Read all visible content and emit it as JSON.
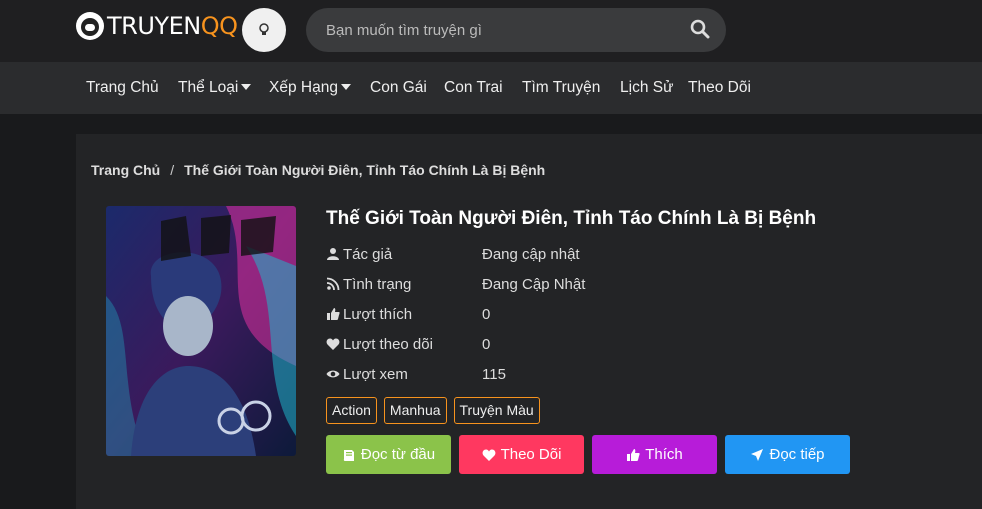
{
  "header": {
    "logo_main": "TRUYEN",
    "logo_accent": "QQ",
    "search_placeholder": "Bạn muốn tìm truyện gì"
  },
  "nav": {
    "items": [
      {
        "label": "Trang Chủ"
      },
      {
        "label": "Thể Loại"
      },
      {
        "label": "Xếp Hạng"
      },
      {
        "label": "Con Gái"
      },
      {
        "label": "Con Trai"
      },
      {
        "label": "Tìm Truyện"
      },
      {
        "label": "Lịch Sử"
      },
      {
        "label": "Theo Dõi"
      }
    ]
  },
  "breadcrumb": {
    "home": "Trang Chủ",
    "separator": "/",
    "current": "Thế Giới Toàn Người Điên, Tỉnh Táo Chính Là Bị Bệnh"
  },
  "comic": {
    "title": "Thế Giới Toàn Người Điên, Tỉnh Táo Chính Là Bị Bệnh",
    "info": [
      {
        "label": "Tác giả",
        "value": "Đang cập nhật",
        "icon": "user-icon"
      },
      {
        "label": "Tình trạng",
        "value": "Đang Cập Nhật",
        "icon": "rss-icon"
      },
      {
        "label": "Lượt thích",
        "value": "0",
        "icon": "thumbs-up-icon"
      },
      {
        "label": "Lượt theo dõi",
        "value": "0",
        "icon": "heart-icon"
      },
      {
        "label": "Lượt xem",
        "value": "115",
        "icon": "eye-icon"
      }
    ],
    "tags": [
      "Action",
      "Manhua",
      "Truyện Màu"
    ]
  },
  "actions": {
    "read_from_start": "Đọc từ đầu",
    "follow": "Theo Dõi",
    "like": "Thích",
    "continue": "Đọc tiếp"
  },
  "colors": {
    "accent": "#f7931e",
    "read": "#8bc34a",
    "follow": "#ff3860",
    "like": "#b71cd9",
    "continue": "#2196f3"
  }
}
